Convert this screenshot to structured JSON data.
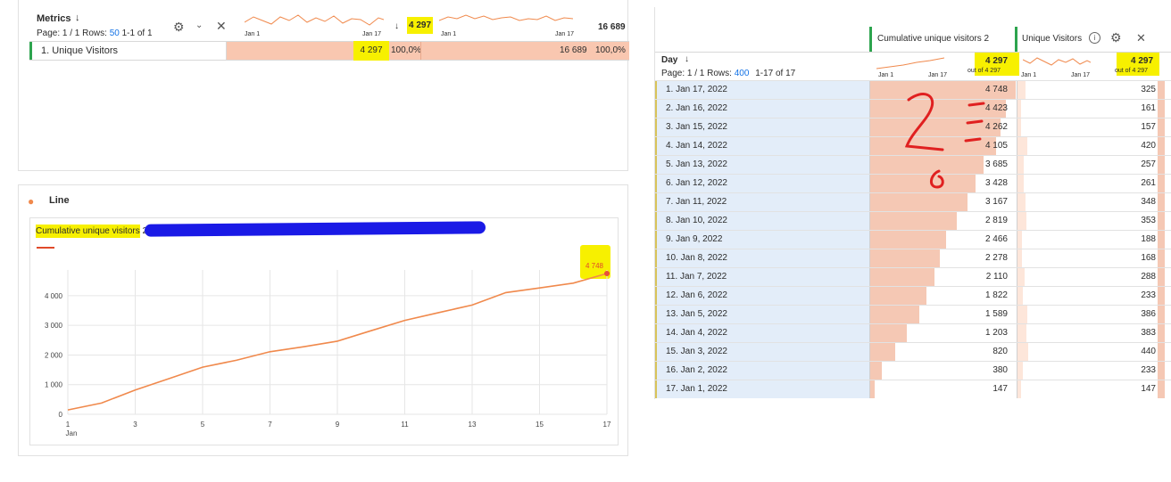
{
  "metrics_table": {
    "title": "Metrics",
    "page_info": "Page: 1 / 1 Rows:",
    "rows_value": "50",
    "range": "1-1 of 1",
    "spark1_start": "Jan 1",
    "spark1_end": "Jan 17",
    "total1": "4 297",
    "spark2_start": "Jan 1",
    "spark2_end": "Jan 17",
    "total2": "16 689",
    "row": {
      "label": "1. Unique Visitors",
      "value1": "4 297",
      "pct1": "100,0%",
      "value2": "16 689",
      "pct2": "100,0%"
    }
  },
  "line_panel": {
    "title": "Line",
    "series_label": "Cumulative unique visitors",
    "series_suffix": "2 [",
    "last_value_label": "4 748"
  },
  "chart_data": {
    "type": "line",
    "title": "",
    "xlabel": "",
    "ylabel": "",
    "x": [
      1,
      2,
      3,
      4,
      5,
      6,
      7,
      8,
      9,
      10,
      11,
      12,
      13,
      14,
      15,
      16,
      17
    ],
    "x_tick_labels": [
      "1",
      "3",
      "5",
      "7",
      "9",
      "11",
      "13",
      "15",
      "17"
    ],
    "x_tick_values": [
      1,
      3,
      5,
      7,
      9,
      11,
      13,
      15,
      17
    ],
    "x_sublabel": "Jan",
    "series": [
      {
        "values": [
          147,
          380,
          820,
          1203,
          1589,
          1822,
          2110,
          2278,
          2466,
          2819,
          3167,
          3428,
          3685,
          4105,
          4262,
          4423,
          4748
        ],
        "color": "#f0894c"
      }
    ],
    "ylim": [
      0,
      4748
    ],
    "y_ticks": [
      0,
      1000,
      2000,
      3000,
      4000
    ],
    "y_tick_labels": [
      "0",
      "1 000",
      "2 000",
      "3 000",
      "4 000"
    ],
    "grid": true,
    "legend": "none"
  },
  "day_table": {
    "col1_header": "Cumulative unique visitors 2",
    "col2_header": "Unique Visitors",
    "dimension": "Day",
    "page_info": "Page: 1 / 1 Rows:",
    "rows_value": "400",
    "range": "1-17 of 17",
    "spark_start": "Jan 1",
    "spark_end": "Jan 17",
    "total1": "4 297",
    "out_of1": "out of 4 297",
    "total2": "4 297",
    "out_of2": "out of 4 297",
    "rows": [
      {
        "label": "1. Jan 17, 2022",
        "v1": "4 748",
        "n1": 4748,
        "v2": "325",
        "n2": 325
      },
      {
        "label": "2. Jan 16, 2022",
        "v1": "4 423",
        "n1": 4423,
        "v2": "161",
        "n2": 161
      },
      {
        "label": "3. Jan 15, 2022",
        "v1": "4 262",
        "n1": 4262,
        "v2": "157",
        "n2": 157
      },
      {
        "label": "4. Jan 14, 2022",
        "v1": "4 105",
        "n1": 4105,
        "v2": "420",
        "n2": 420
      },
      {
        "label": "5. Jan 13, 2022",
        "v1": "3 685",
        "n1": 3685,
        "v2": "257",
        "n2": 257
      },
      {
        "label": "6. Jan 12, 2022",
        "v1": "3 428",
        "n1": 3428,
        "v2": "261",
        "n2": 261
      },
      {
        "label": "7. Jan 11, 2022",
        "v1": "3 167",
        "n1": 3167,
        "v2": "348",
        "n2": 348
      },
      {
        "label": "8. Jan 10, 2022",
        "v1": "2 819",
        "n1": 2819,
        "v2": "353",
        "n2": 353
      },
      {
        "label": "9. Jan 9, 2022",
        "v1": "2 466",
        "n1": 2466,
        "v2": "188",
        "n2": 188
      },
      {
        "label": "10. Jan 8, 2022",
        "v1": "2 278",
        "n1": 2278,
        "v2": "168",
        "n2": 168
      },
      {
        "label": "11. Jan 7, 2022",
        "v1": "2 110",
        "n1": 2110,
        "v2": "288",
        "n2": 288
      },
      {
        "label": "12. Jan 6, 2022",
        "v1": "1 822",
        "n1": 1822,
        "v2": "233",
        "n2": 233
      },
      {
        "label": "13. Jan 5, 2022",
        "v1": "1 589",
        "n1": 1589,
        "v2": "386",
        "n2": 386
      },
      {
        "label": "14. Jan 4, 2022",
        "v1": "1 203",
        "n1": 1203,
        "v2": "383",
        "n2": 383
      },
      {
        "label": "15. Jan 3, 2022",
        "v1": "820",
        "n1": 820,
        "v2": "440",
        "n2": 440
      },
      {
        "label": "16. Jan 2, 2022",
        "v1": "380",
        "n1": 380,
        "v2": "233",
        "n2": 233
      },
      {
        "label": "17. Jan 1, 2022",
        "v1": "147",
        "n1": 147,
        "v2": "147",
        "n2": 147
      }
    ]
  },
  "colors": {
    "accent": "#f0894c",
    "highlight": "#f7f000",
    "bar_fill": "#f5c8b4",
    "row_label_bg": "#e3edf9",
    "link": "#1473e6",
    "redaction": "#1a1ae6",
    "annotation": "#e02020"
  }
}
